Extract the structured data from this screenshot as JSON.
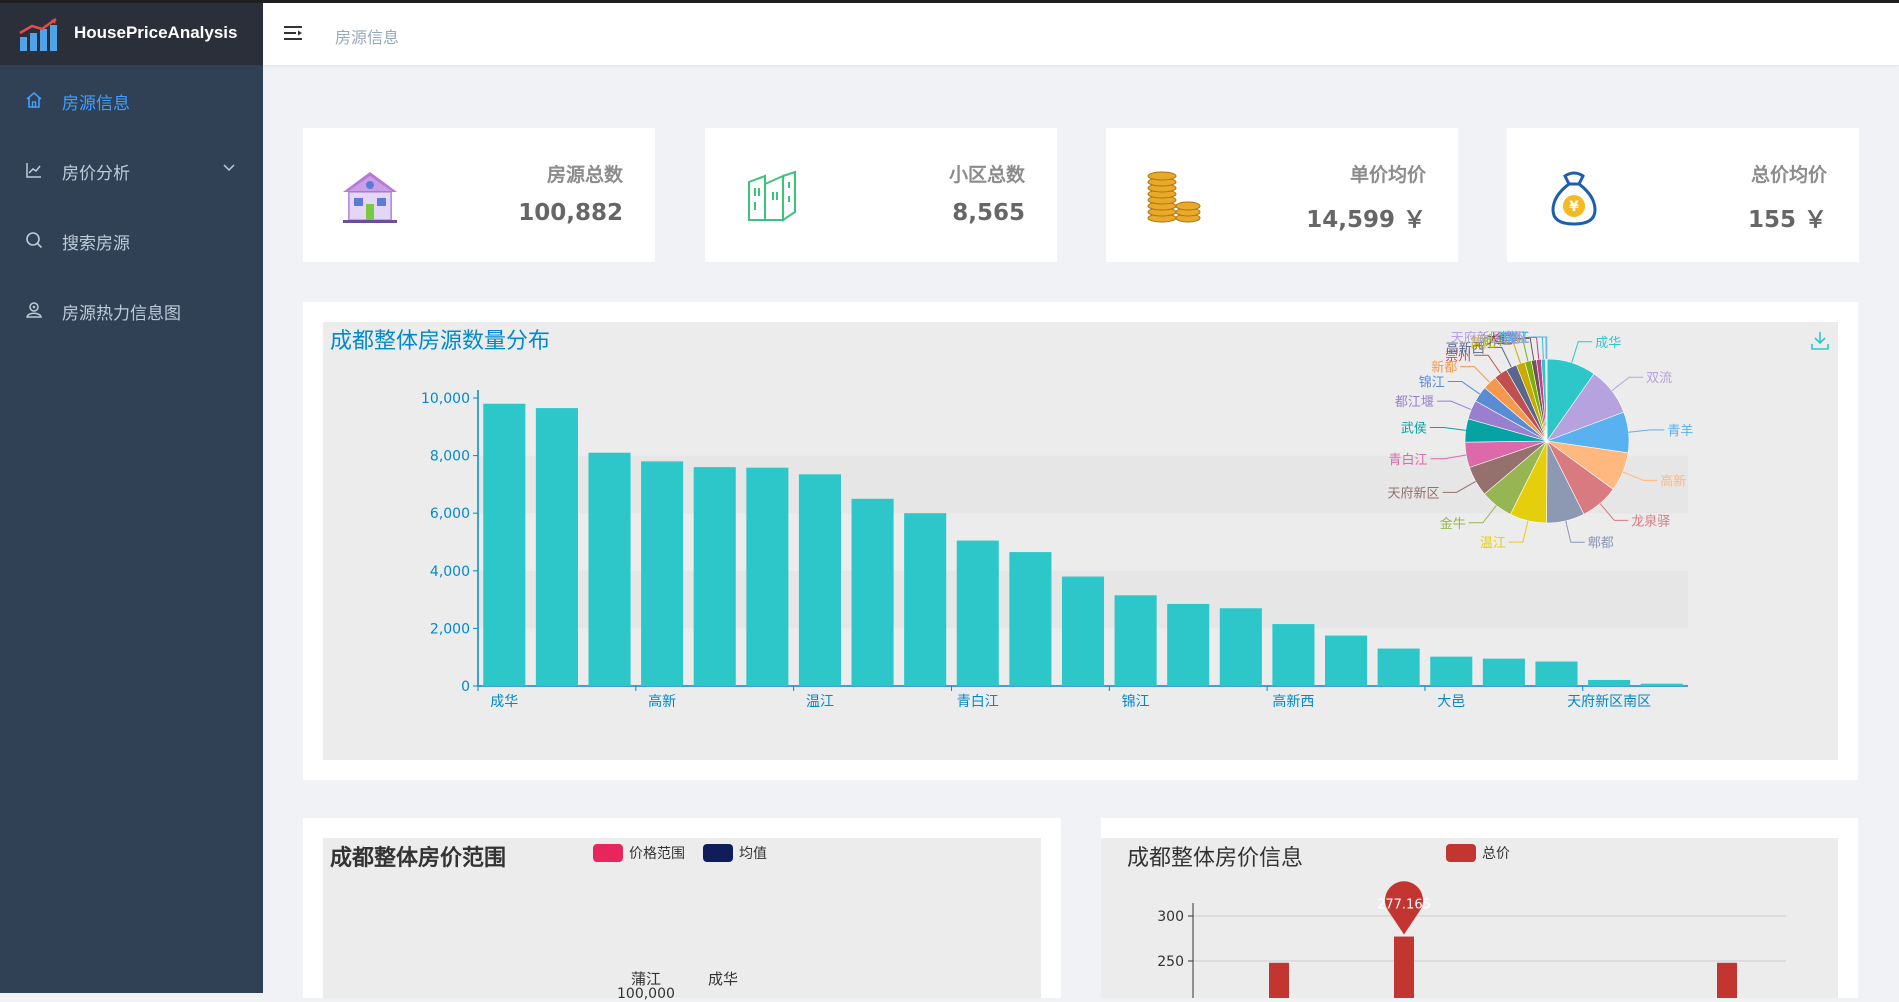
{
  "app": {
    "name": "HousePriceAnalysis"
  },
  "sidebar": {
    "items": [
      {
        "label": "房源信息",
        "icon": "home-icon",
        "active": true
      },
      {
        "label": "房价分析",
        "icon": "line-chart-icon",
        "has_children": true
      },
      {
        "label": "搜索房源",
        "icon": "search-icon"
      },
      {
        "label": "房源热力信息图",
        "icon": "user-location-icon"
      }
    ]
  },
  "navbar": {
    "breadcrumb": "房源信息"
  },
  "stats": [
    {
      "label": "房源总数",
      "value": "100,882",
      "icon": "house-icon"
    },
    {
      "label": "小区总数",
      "value": "8,565",
      "icon": "building-icon"
    },
    {
      "label": "单价均价",
      "value": "14,599 ￥",
      "icon": "coins-icon"
    },
    {
      "label": "总价均价",
      "value": "155 ￥",
      "icon": "money-bag-icon"
    }
  ],
  "distribution": {
    "title": "成都整体房源数量分布",
    "bar_color": "#2ec7c9",
    "accent_color": "#008acd"
  },
  "chart_data": [
    {
      "type": "bar",
      "title": "成都整体房源数量分布",
      "categories": [
        "成华",
        "双流",
        "青羊",
        "高新",
        "龙泉驿",
        "郫都",
        "温江",
        "金牛",
        "天府新区",
        "青白江",
        "武侯",
        "都江堰",
        "锦江",
        "新都",
        "崇州",
        "高新西",
        "简阳",
        "新津",
        "大邑",
        "金堂",
        "彭州",
        "天府新区南区",
        "蒲江"
      ],
      "tick_labels": [
        "成华",
        "高新",
        "温江",
        "青白江",
        "锦江",
        "高新西",
        "大邑",
        "天府新区南区"
      ],
      "values": [
        9800,
        9650,
        8100,
        7800,
        7600,
        7580,
        7350,
        6500,
        6000,
        5050,
        4650,
        3800,
        3150,
        2850,
        2700,
        2150,
        1750,
        1300,
        1020,
        950,
        850,
        210,
        80
      ],
      "ylim": [
        0,
        10000
      ],
      "yticks": [
        "0",
        "2,000",
        "4,000",
        "6,000",
        "8,000",
        "10,000"
      ]
    },
    {
      "type": "pie",
      "labels": [
        "成华",
        "双流",
        "青羊",
        "高新",
        "龙泉驿",
        "郫都",
        "温江",
        "金牛",
        "天府新区",
        "青白江",
        "武侯",
        "都江堰",
        "锦江",
        "新都",
        "崇州",
        "高新西",
        "简阳",
        "新津",
        "大邑",
        "金堂",
        "彭州",
        "天府新区南区",
        "蒲江"
      ],
      "values": [
        9800,
        9650,
        8100,
        7800,
        7600,
        7580,
        7350,
        6500,
        6000,
        5050,
        4650,
        3800,
        3150,
        2850,
        2700,
        2150,
        1750,
        1300,
        1020,
        950,
        850,
        210,
        80
      ],
      "colors": [
        "#2ec7c9",
        "#b6a2de",
        "#5ab1ef",
        "#ffb980",
        "#d87a80",
        "#8d98b3",
        "#e5cf0d",
        "#97b552",
        "#95706d",
        "#dc69aa",
        "#07a2a4",
        "#9a7fd1",
        "#588dd5",
        "#f5994e",
        "#c05050",
        "#59678c",
        "#c9ab00",
        "#7eb00a",
        "#6f5553",
        "#c14089",
        "#2ec7c9",
        "#b6a2de",
        "#5ab1ef"
      ]
    },
    {
      "type": "bar",
      "title": "成都整体房价范围",
      "legend": [
        "价格范围",
        "均值"
      ],
      "legend_colors": [
        "#e8265b",
        "#0f1e5a"
      ],
      "visible_labels": [
        "蒲江",
        "成华"
      ],
      "visible_tick": "100,000"
    },
    {
      "type": "bar",
      "title": "成都整体房价信息",
      "legend": [
        "总价"
      ],
      "legend_colors": [
        "#c23531"
      ],
      "yticks": [
        "250",
        "300"
      ],
      "visible_values": [
        248,
        277.165,
        248
      ],
      "max_label": "277.165"
    }
  ],
  "range_panel": {
    "title": "成都整体房价范围",
    "legend": [
      "价格范围",
      "均值"
    ],
    "labels": [
      "蒲江",
      "成华"
    ],
    "tick": "100,000"
  },
  "price_panel": {
    "title": "成都整体房价信息",
    "legend": [
      "总价"
    ],
    "yticks": [
      "300",
      "250"
    ],
    "max_label": "277.165"
  }
}
